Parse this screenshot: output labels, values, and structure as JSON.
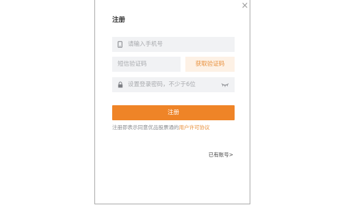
{
  "dialog": {
    "close_glyph": "×",
    "title": "注册"
  },
  "form": {
    "phone": {
      "placeholder": "请输入手机号",
      "icon": "phone-icon"
    },
    "code": {
      "placeholder": "短信验证码"
    },
    "send_code_label": "获取验证码",
    "password": {
      "placeholder": "设置登录密码，不少于6位",
      "icon": "lock-icon",
      "toggle_icon": "eye-closed-icon"
    },
    "submit_label": "注册",
    "agreement_text": "注册即表示同意优品股票通的",
    "agreement_link": "用户许可协议"
  },
  "footer": {
    "login_link": "已有账号>"
  },
  "colors": {
    "accent": "#ef8427",
    "accent_text": "#e88f3a",
    "accent_soft": "#fdf1e5",
    "field_bg": "#f1f2f4",
    "placeholder": "#a7a9ad"
  }
}
